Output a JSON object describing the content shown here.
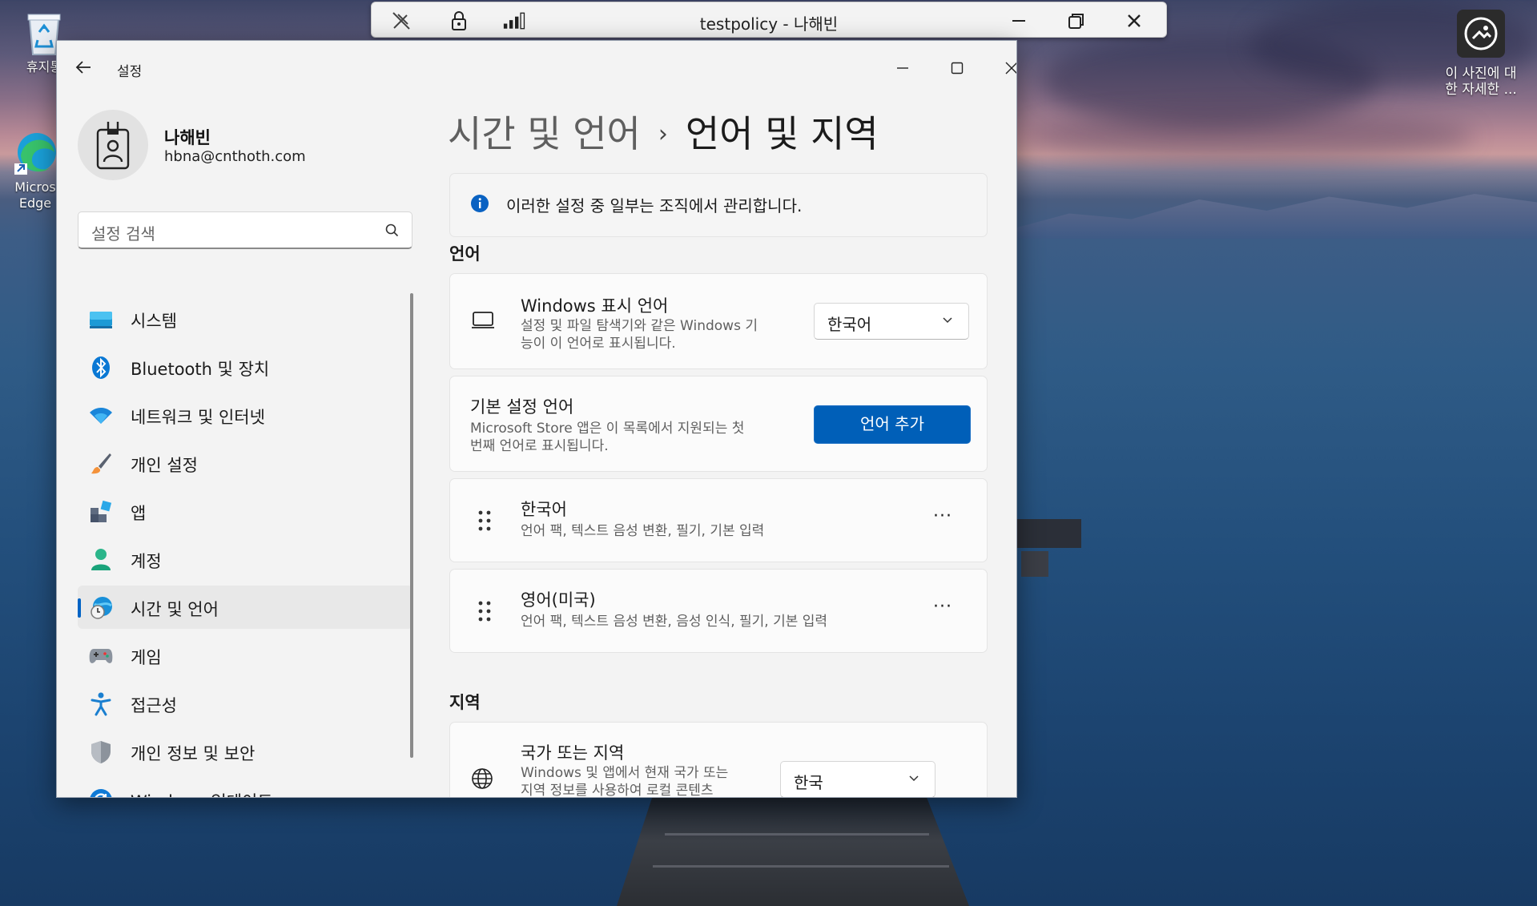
{
  "desktop": {
    "icons": [
      {
        "name": "recycle-bin",
        "label": "휴지통"
      },
      {
        "name": "edge",
        "label": "Micros\nEdge"
      }
    ],
    "photo_info_label": "이 사진에 대\n한 자세한 ..."
  },
  "remote_bar": {
    "title": "testpolicy - 나해빈"
  },
  "window": {
    "app_title": "설정",
    "user": {
      "name": "나해빈",
      "email": "hbna@cnthoth.com"
    },
    "search": {
      "placeholder": "설정 검색"
    },
    "nav": [
      {
        "label": "시스템",
        "icon": "system-icon"
      },
      {
        "label": "Bluetooth 및 장치",
        "icon": "bluetooth-icon"
      },
      {
        "label": "네트워크 및 인터넷",
        "icon": "wifi-icon"
      },
      {
        "label": "개인 설정",
        "icon": "brush-icon"
      },
      {
        "label": "앱",
        "icon": "apps-icon"
      },
      {
        "label": "계정",
        "icon": "account-icon"
      },
      {
        "label": "시간 및 언어",
        "icon": "time-language-icon",
        "active": true
      },
      {
        "label": "게임",
        "icon": "gamepad-icon"
      },
      {
        "label": "접근성",
        "icon": "accessibility-icon"
      },
      {
        "label": "개인 정보 및 보안",
        "icon": "shield-icon"
      },
      {
        "label": "Windows 업데이트",
        "icon": "update-icon"
      }
    ],
    "breadcrumb": {
      "parent": "시간 및 언어",
      "separator": "›",
      "current": "언어 및 지역"
    },
    "info_banner": "이러한 설정 중 일부는 조직에서 관리합니다.",
    "language_section": {
      "heading": "언어",
      "display_language": {
        "title": "Windows 표시 언어",
        "desc_line1": "설정 및 파일 탐색기와 같은 Windows 기",
        "desc_line2": "능이 이 언어로 표시됩니다.",
        "value": "한국어"
      },
      "preferred": {
        "title": "기본 설정 언어",
        "desc_line1": "Microsoft Store 앱은 이 목록에서 지원되는 첫",
        "desc_line2": "번째 언어로 표시됩니다.",
        "button": "언어 추가"
      },
      "languages": [
        {
          "name": "한국어",
          "features": "언어 팩, 텍스트 음성 변환, 필기, 기본 입력"
        },
        {
          "name": "영어(미국)",
          "features": "언어 팩, 텍스트 음성 변환, 음성 인식, 필기, 기본 입력"
        }
      ],
      "more_label": "···"
    },
    "region_section": {
      "heading": "지역",
      "country": {
        "title": "국가 또는 지역",
        "desc_line1": "Windows 및 앱에서 현재 국가 또는",
        "desc_line2": "지역 정보를 사용하여 로컬 콘텐츠",
        "value": "한국"
      }
    }
  },
  "colors": {
    "accent": "#005fb8",
    "nav_indicator": "#0063c4"
  }
}
